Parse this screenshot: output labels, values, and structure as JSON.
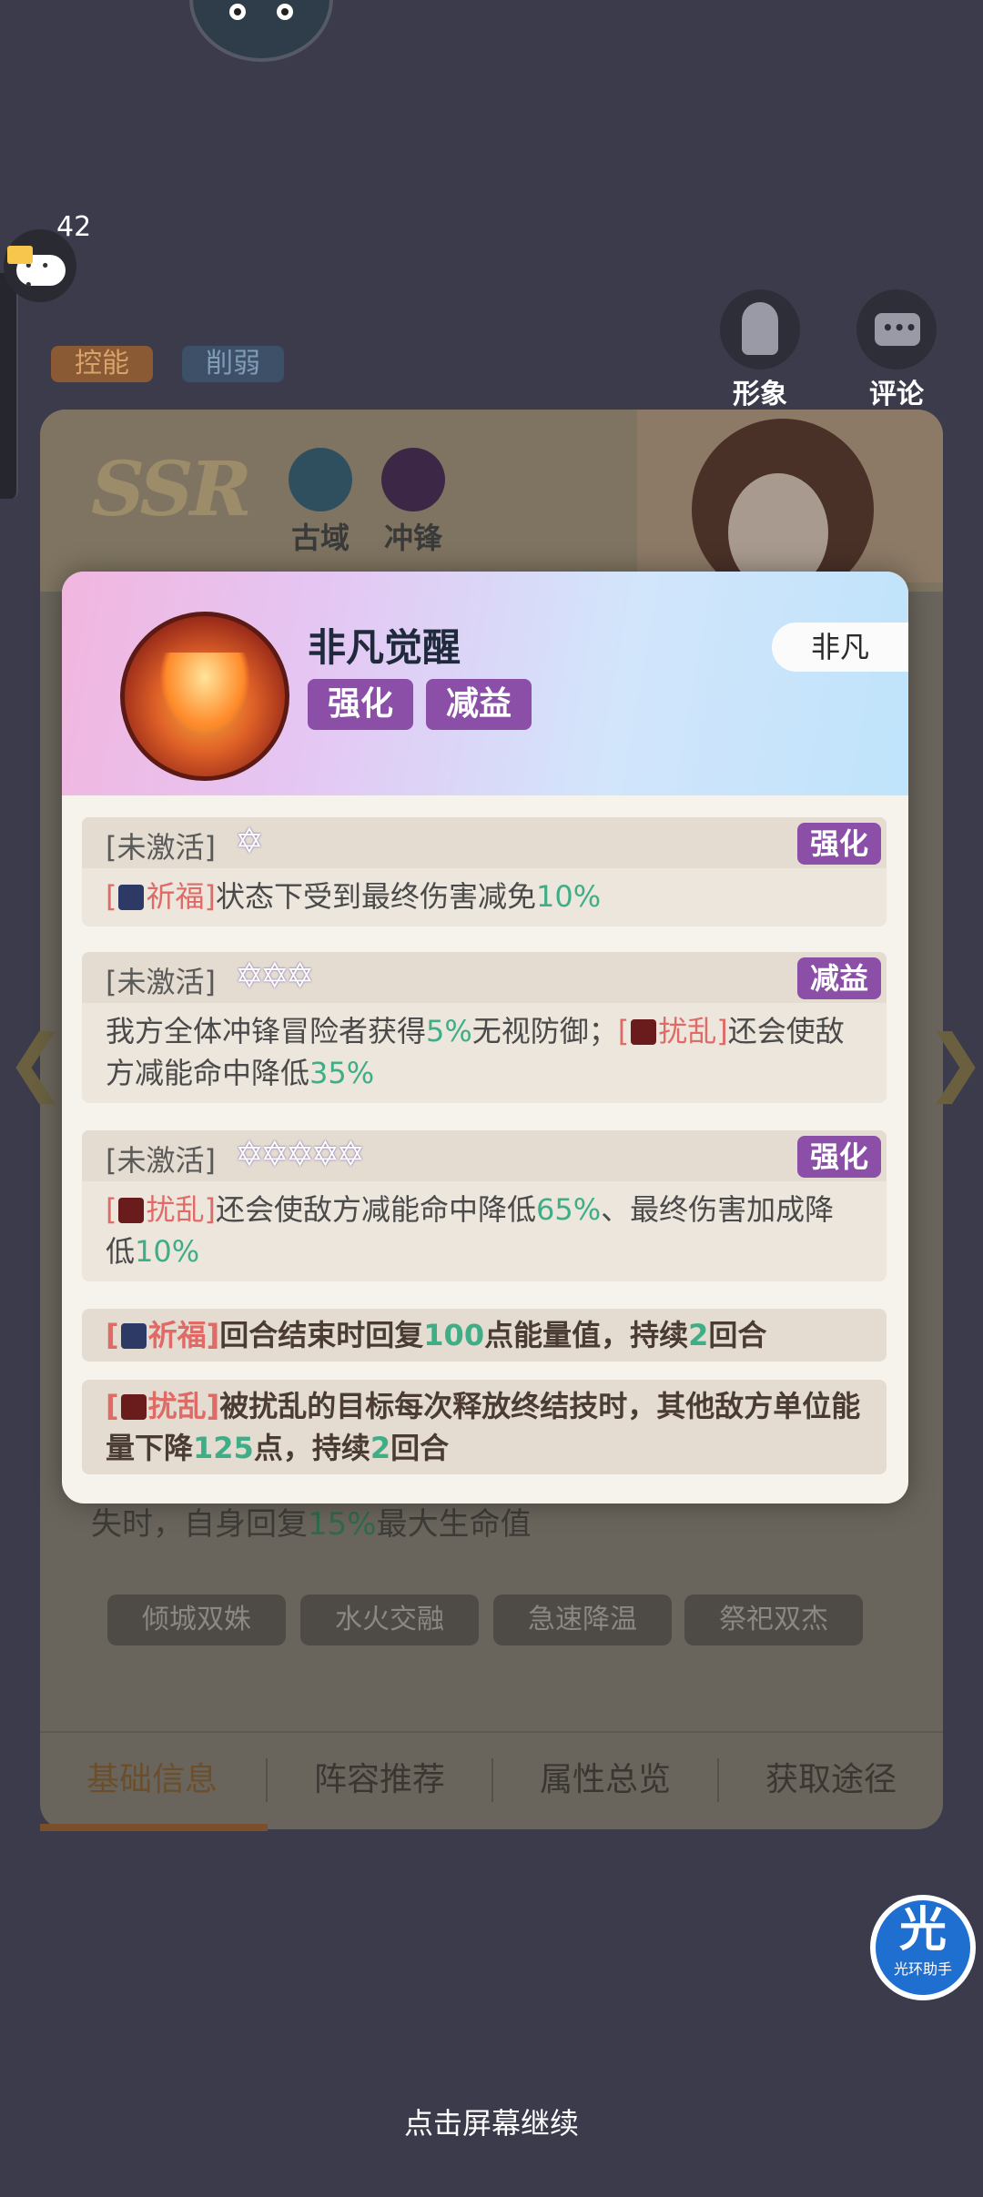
{
  "floating": {
    "chat_count": "42"
  },
  "tags": {
    "control": "控能",
    "weaken": "削弱"
  },
  "side_buttons": {
    "image": "形象",
    "comment": "评论"
  },
  "hero_card": {
    "rarity": "SSR",
    "factions": [
      "古域",
      "冲锋"
    ],
    "bg_text": {
      "before": "失时，自身回复",
      "value": "15%",
      "after": "最大生命值"
    },
    "chips": [
      "倾城双姝",
      "水火交融",
      "急速降温",
      "祭祀双杰"
    ],
    "tabs": [
      "基础信息",
      "阵容推荐",
      "属性总览",
      "获取途径"
    ]
  },
  "modal": {
    "skill_name": "非凡觉醒",
    "rarity_label": "非凡",
    "tags": [
      "强化",
      "减益"
    ],
    "rows": [
      {
        "status": "[未激活]",
        "stars": "✡",
        "badge": "强化",
        "p1": "[",
        "p2": "祈福",
        "p3": "]",
        "p4": "状态下受到最终伤害减免",
        "p5": "10%"
      },
      {
        "status": "[未激活]",
        "stars": "✡✡✡",
        "badge": "减益",
        "p1": "我方全体冲锋冒险者获得",
        "p2": "5%",
        "p3": "无视防御；",
        "p4": "[",
        "p5": "扰乱",
        "p6": "]",
        "p7": "还会使敌方减能命中降低",
        "p8": "35%"
      },
      {
        "status": "[未激活]",
        "stars": "✡✡✡✡✡",
        "badge": "强化",
        "p1": "[",
        "p2": "扰乱",
        "p3": "]",
        "p4": "还会使敌方减能命中降低",
        "p5": "65%",
        "p6": "、最终伤害加成降低",
        "p7": "10%"
      }
    ],
    "footnotes": [
      {
        "p1": "[",
        "p2": "祈福",
        "p3": "]",
        "p4": "回合结束时回复",
        "p5": "100",
        "p6": "点能量值，持续",
        "p7": "2",
        "p8": "回合"
      },
      {
        "p1": "[",
        "p2": "扰乱",
        "p3": "]",
        "p4": "被扰乱的目标每次释放终结技时，其他敌方单位能量下降",
        "p5": "125",
        "p6": "点，持续",
        "p7": "2",
        "p8": "回合"
      }
    ]
  },
  "continue_hint": "点击屏幕继续",
  "helper": {
    "big": "光",
    "small": "光环助手"
  },
  "colors": {
    "badge": "#8b4fa8",
    "highlight_green": "#3fae87",
    "highlight_red": "#e06a66"
  }
}
